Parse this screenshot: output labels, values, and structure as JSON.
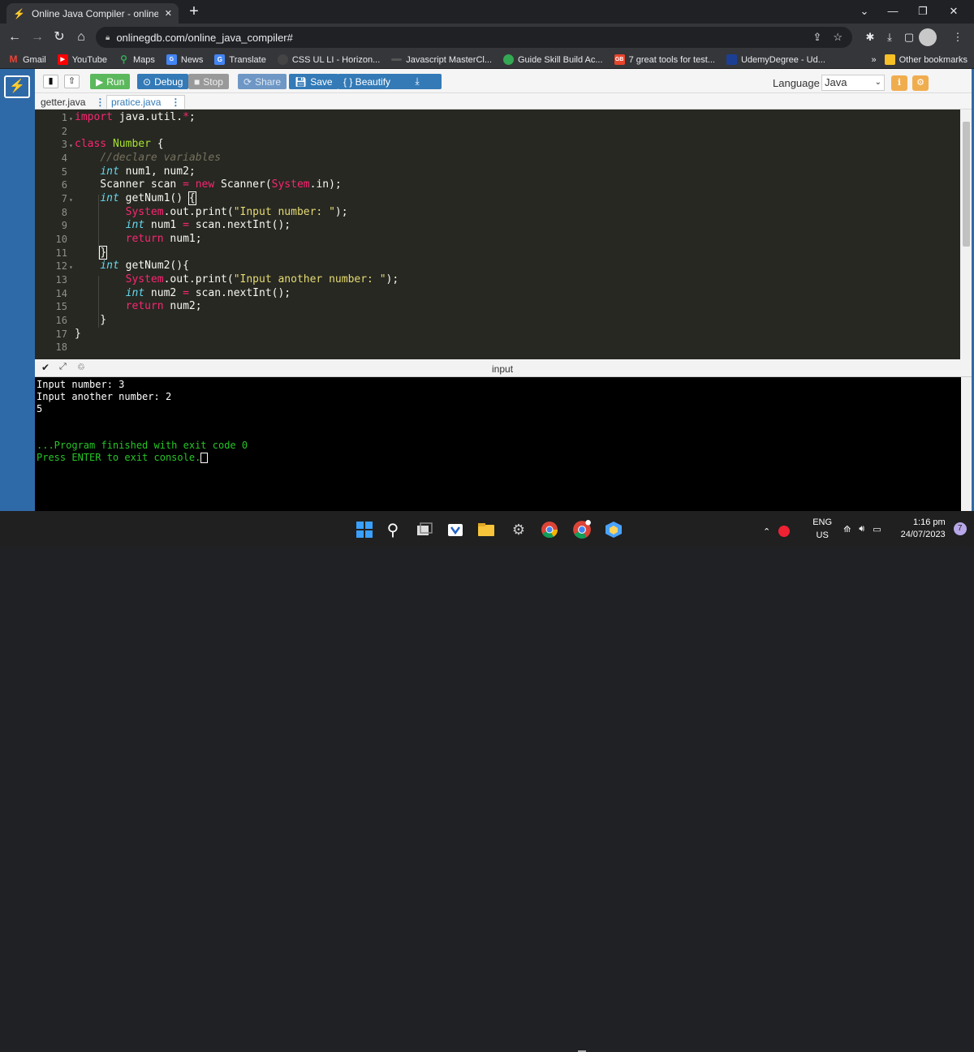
{
  "browser": {
    "tab_title": "Online Java Compiler - online edi",
    "new_tab": "+",
    "url": "onlinegdb.com/online_java_compiler#"
  },
  "bookmarks": [
    {
      "label": "Gmail",
      "icon": "gmail-icon"
    },
    {
      "label": "YouTube",
      "icon": "youtube-icon"
    },
    {
      "label": "Maps",
      "icon": "maps-icon"
    },
    {
      "label": "News",
      "icon": "news-icon"
    },
    {
      "label": "Translate",
      "icon": "translate-icon"
    },
    {
      "label": "CSS UL LI - Horizon...",
      "icon": "site-icon"
    },
    {
      "label": "Javascript MasterCl...",
      "icon": "site-icon"
    },
    {
      "label": "Guide Skill Build Ac...",
      "icon": "site-icon"
    },
    {
      "label": "7 great tools for test...",
      "icon": "site-icon"
    },
    {
      "label": "UdemyDegree - Ud...",
      "icon": "site-icon"
    }
  ],
  "bookmarks_more": "»",
  "other_bookmarks": "Other bookmarks",
  "toolbar": {
    "run": "Run",
    "debug": "Debug",
    "stop": "Stop",
    "share": "Share",
    "save": "Save",
    "beautify": "{ } Beautify",
    "language_label": "Language",
    "language_value": "Java"
  },
  "files": [
    {
      "name": "getter.java",
      "active": false
    },
    {
      "name": "pratice.java",
      "active": true
    }
  ],
  "editor": {
    "line_numbers": [
      "1",
      "2",
      "3",
      "4",
      "5",
      "6",
      "7",
      "8",
      "9",
      "10",
      "11",
      "12",
      "13",
      "14",
      "15",
      "16",
      "17",
      "18"
    ]
  },
  "console": {
    "tab_label": "input",
    "lines": [
      "Input number: 3",
      "Input another number: 2",
      "5",
      "",
      "",
      "...Program finished with exit code 0",
      "Press ENTER to exit console."
    ]
  },
  "taskbar": {
    "lang_top": "ENG",
    "lang_bottom": "US",
    "time": "1:16 pm",
    "date": "24/07/2023",
    "notif_count": "7"
  },
  "colors": {
    "rail": "#2f6aa8",
    "run": "#5cb85c",
    "button_blue": "#337ab7",
    "editor_bg": "#272822",
    "console_bg": "#000000"
  }
}
